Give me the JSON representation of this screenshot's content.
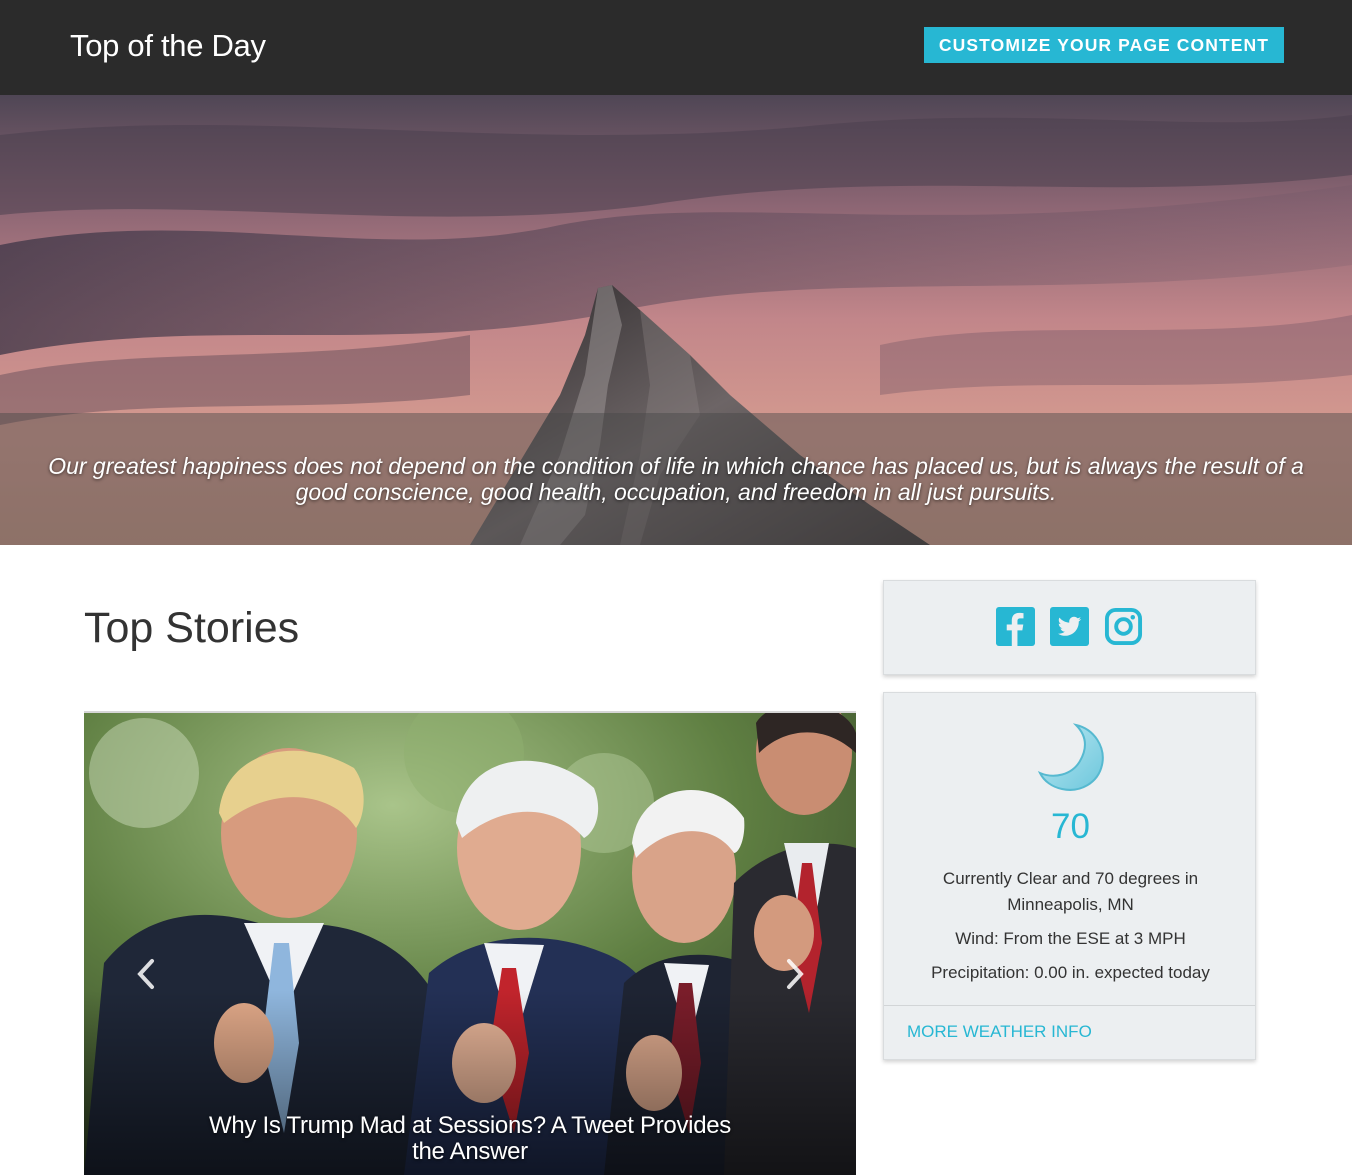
{
  "header": {
    "brand": "Top of the Day",
    "cta_label": "CUSTOMIZE YOUR PAGE CONTENT"
  },
  "hero": {
    "quote": "Our greatest happiness does not depend on the condition of life in which chance has placed us, but is always the result of a good conscience, good health, occupation, and freedom in all just pursuits."
  },
  "main": {
    "section_title": "Top Stories",
    "carousel": {
      "slides": [
        {
          "caption": "Why Is Trump Mad at Sessions? A Tweet Provides the Answer"
        }
      ],
      "prev_icon": "chevron-left-icon",
      "next_icon": "chevron-right-icon"
    }
  },
  "sidebar": {
    "social": {
      "icons": [
        "facebook-icon",
        "twitter-icon",
        "instagram-icon"
      ]
    },
    "weather": {
      "icon": "moon-icon",
      "temperature": "70",
      "current": "Currently Clear and 70 degrees in Minneapolis, MN",
      "wind": "Wind: From the ESE at 3 MPH",
      "precipitation": "Precipitation: 0.00 in. expected today",
      "more_link": "MORE WEATHER INFO"
    }
  },
  "colors": {
    "navbar_bg": "#2b2b2b",
    "accent": "#27b7d3",
    "card_bg": "#eceff1"
  }
}
